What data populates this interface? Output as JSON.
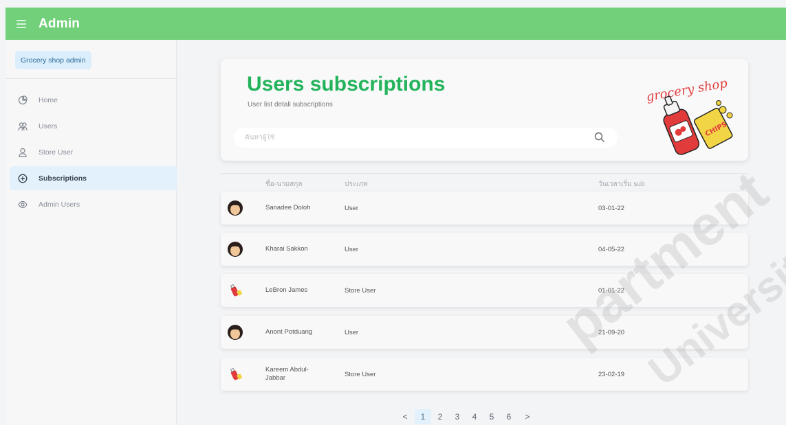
{
  "app": {
    "title": "Admin"
  },
  "sidebar": {
    "shop_label": "Grocery shop admin",
    "items": [
      {
        "label": "Home",
        "icon": "pie-chart-icon",
        "active": false
      },
      {
        "label": "Users",
        "icon": "users-icon",
        "active": false
      },
      {
        "label": "Store User",
        "icon": "user-icon",
        "active": false
      },
      {
        "label": "Subscriptions",
        "icon": "plus-circle-icon",
        "active": true
      },
      {
        "label": "Admin Users",
        "icon": "eye-icon",
        "active": false
      }
    ]
  },
  "header": {
    "title": "Users subscriptions",
    "subtitle": "User list detali subscriptions",
    "search_placeholder": "ค้นหาผู้ใช้",
    "logo_text": "grocery shop",
    "logo_label": "CHIPS"
  },
  "table": {
    "columns": [
      "ชื่อ-นามสกุล",
      "ประเภท",
      "วันเวลาเริ่ม sub"
    ],
    "rows": [
      {
        "name": "Sanadee Doloh",
        "type": "User",
        "date": "03-01-22",
        "avatar": "person-avatar"
      },
      {
        "name": "Kharai Sakkon",
        "type": "User",
        "date": "04-05-22",
        "avatar": "person-avatar"
      },
      {
        "name": "LeBron James",
        "type": "Store User",
        "date": "01-01-22",
        "avatar": "grocery-logo-avatar"
      },
      {
        "name": "Anont Potduang",
        "type": "User",
        "date": "21-09-20",
        "avatar": "person-avatar"
      },
      {
        "name": "Kareem Abdul-Jabbar",
        "type": "Store User",
        "date": "23-02-19",
        "avatar": "grocery-logo-avatar"
      }
    ]
  },
  "pagination": {
    "prev": "<",
    "next": ">",
    "pages": [
      "1",
      "2",
      "3",
      "4",
      "5",
      "6"
    ],
    "current": "1"
  },
  "watermark": {
    "line1": "partment",
    "line2": "University"
  },
  "colors": {
    "topbar": "#73d07a",
    "title": "#22b35b",
    "active_bg": "#e2f1fb"
  }
}
